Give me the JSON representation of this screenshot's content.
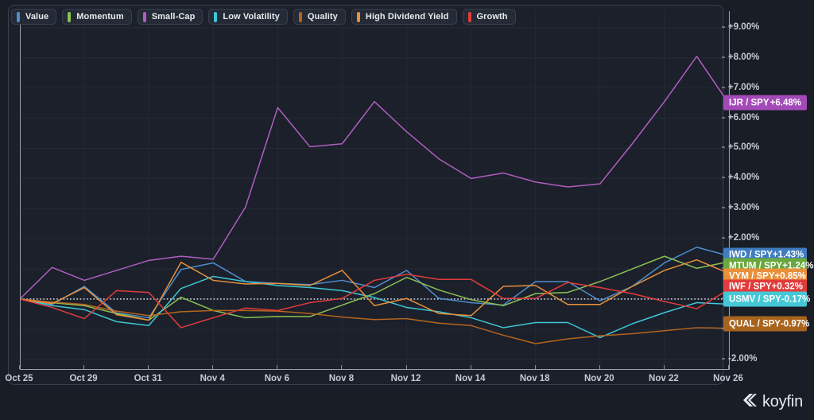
{
  "legend": {
    "items": [
      {
        "label": "Value",
        "color": "#4f8ecc"
      },
      {
        "label": "Momentum",
        "color": "#8cc152"
      },
      {
        "label": "Small-Cap",
        "color": "#b05ec0"
      },
      {
        "label": "Low Volatility",
        "color": "#3fc6d4"
      },
      {
        "label": "Quality",
        "color": "#b5651d"
      },
      {
        "label": "High Dividend Yield",
        "color": "#e8903a"
      },
      {
        "label": "Growth",
        "color": "#e23b3b"
      }
    ]
  },
  "badges": [
    {
      "name": "IJR / SPY",
      "value": "+6.48%",
      "color": "#a349b8",
      "y": 6.48
    },
    {
      "name": "IWD / SPY",
      "value": "+1.43%",
      "color": "#3f7cc0",
      "y": 1.43
    },
    {
      "name": "MTUM / SPY",
      "value": "+1.24%",
      "color": "#69a83c",
      "y": 1.08
    },
    {
      "name": "VYM / SPY",
      "value": "+0.85%",
      "color": "#e8903a",
      "y": 0.73
    },
    {
      "name": "IWF / SPY",
      "value": "+0.32%",
      "color": "#e23b3b",
      "y": 0.38
    },
    {
      "name": "USMV / SPY",
      "value": "-0.17%",
      "color": "#45c8d6",
      "y": -0.03
    },
    {
      "name": "QUAL / SPY",
      "value": "-0.97%",
      "color": "#a8641e",
      "y": -0.85
    }
  ],
  "watermark": {
    "text": "koyfin",
    "icon": "koyfin-logo-icon"
  },
  "chart_data": {
    "type": "line",
    "title": "",
    "xlabel": "",
    "ylabel": "",
    "ylim": [
      -2.35,
      9.55
    ],
    "yticks": [
      9,
      8,
      7,
      6,
      5,
      4,
      3,
      2,
      1,
      0,
      -1,
      -2
    ],
    "ytick_labels": [
      "+9.00%",
      "+8.00%",
      "+7.00%",
      "+6.00%",
      "+5.00%",
      "+4.00%",
      "+3.00%",
      "+2.00%",
      "+1.00%",
      "0.00%",
      "-1.00%",
      "-2.00%"
    ],
    "grid": true,
    "zero_line": true,
    "legend_position": "top-left",
    "x": [
      "Oct 25",
      "Oct 28",
      "Oct 29",
      "Oct 30",
      "Oct 31",
      "Nov 1",
      "Nov 4",
      "Nov 5",
      "Nov 6",
      "Nov 7",
      "Nov 8",
      "Nov 11",
      "Nov 12",
      "Nov 13",
      "Nov 14",
      "Nov 15",
      "Nov 18",
      "Nov 19",
      "Nov 20",
      "Nov 21",
      "Nov 22",
      "Nov 25",
      "Nov 26"
    ],
    "xtick_labels": [
      "Oct 25",
      "Oct 29",
      "Oct 31",
      "Nov 4",
      "Nov 6",
      "Nov 8",
      "Nov 12",
      "Nov 14",
      "Nov 18",
      "Nov 20",
      "Nov 22",
      "Nov 26"
    ],
    "xtick_indices": [
      0,
      2,
      4,
      6,
      8,
      10,
      12,
      14,
      16,
      18,
      20,
      22
    ],
    "series": [
      {
        "name": "Value",
        "ticker": "IWD / SPY",
        "color": "#4f8ecc",
        "values": [
          0.0,
          -0.18,
          0.42,
          -0.46,
          -0.62,
          0.98,
          1.2,
          0.58,
          0.52,
          0.48,
          0.62,
          0.38,
          0.95,
          0.02,
          -0.12,
          -0.2,
          0.58,
          0.58,
          -0.06,
          0.42,
          1.2,
          1.72,
          1.43
        ]
      },
      {
        "name": "Momentum",
        "ticker": "MTUM / SPY",
        "color": "#8cc152",
        "values": [
          0.0,
          -0.12,
          -0.22,
          -0.48,
          -0.7,
          0.06,
          -0.38,
          -0.62,
          -0.58,
          -0.58,
          -0.2,
          0.18,
          0.72,
          0.3,
          -0.02,
          -0.22,
          0.18,
          0.22,
          0.58,
          1.0,
          1.42,
          1.02,
          1.24
        ]
      },
      {
        "name": "Small-Cap",
        "ticker": "IJR / SPY",
        "color": "#b05ec0",
        "values": [
          0.0,
          1.05,
          0.62,
          0.95,
          1.28,
          1.42,
          1.32,
          3.05,
          6.35,
          5.05,
          5.15,
          6.55,
          5.55,
          4.65,
          4.0,
          4.18,
          3.88,
          3.72,
          3.82,
          5.15,
          6.55,
          8.05,
          6.48
        ]
      },
      {
        "name": "Low Volatility",
        "ticker": "USMV / SPY",
        "color": "#3fc6d4",
        "values": [
          0.0,
          -0.22,
          -0.35,
          -0.75,
          -0.88,
          0.35,
          0.75,
          0.58,
          0.45,
          0.38,
          0.28,
          0.05,
          -0.28,
          -0.42,
          -0.62,
          -0.95,
          -0.78,
          -0.78,
          -1.28,
          -0.82,
          -0.45,
          -0.12,
          -0.17
        ]
      },
      {
        "name": "Quality",
        "ticker": "QUAL / SPY",
        "color": "#b5651d",
        "values": [
          0.0,
          -0.1,
          -0.18,
          -0.4,
          -0.55,
          -0.42,
          -0.38,
          -0.38,
          -0.4,
          -0.48,
          -0.6,
          -0.68,
          -0.65,
          -0.8,
          -0.88,
          -1.2,
          -1.48,
          -1.32,
          -1.22,
          -1.15,
          -1.05,
          -0.95,
          -0.97
        ]
      },
      {
        "name": "High Dividend Yield",
        "ticker": "VYM / SPY",
        "color": "#e8903a",
        "values": [
          0.0,
          -0.15,
          0.38,
          -0.52,
          -0.7,
          1.22,
          0.62,
          0.5,
          0.52,
          0.45,
          0.95,
          -0.22,
          0.02,
          -0.48,
          -0.55,
          0.42,
          0.45,
          -0.18,
          -0.18,
          0.42,
          0.95,
          1.3,
          0.85
        ]
      },
      {
        "name": "Growth",
        "ticker": "IWF / SPY",
        "color": "#e23b3b",
        "values": [
          0.0,
          -0.28,
          -0.65,
          0.28,
          0.22,
          -0.95,
          -0.62,
          -0.3,
          -0.38,
          -0.12,
          0.02,
          0.62,
          0.82,
          0.65,
          0.65,
          0.02,
          0.02,
          0.55,
          0.38,
          0.18,
          -0.08,
          -0.32,
          0.32
        ]
      }
    ]
  }
}
